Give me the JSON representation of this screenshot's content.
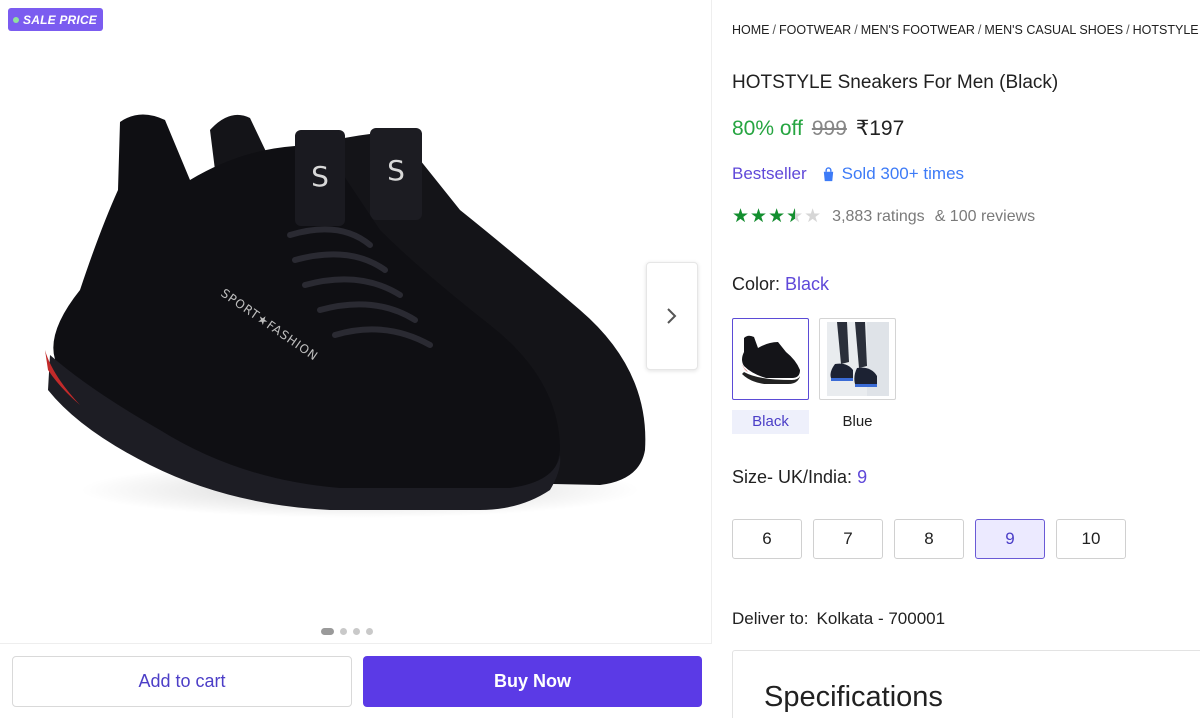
{
  "gallery": {
    "badge": "SALE PRICE",
    "image_count": 4,
    "active_image": 1,
    "add_to_cart_label": "Add to cart",
    "buy_now_label": "Buy Now",
    "next_icon": "chevron-right-icon"
  },
  "breadcrumb": [
    "HOME",
    "FOOTWEAR",
    "MEN'S FOOTWEAR",
    "MEN'S CASUAL SHOES",
    "HOTSTYLE"
  ],
  "product": {
    "title": "HOTSTYLE Sneakers For Men (Black)",
    "discount": "80% off",
    "mrp": "999",
    "price": "₹197",
    "bestseller": "Bestseller",
    "sold": "Sold 300+ times",
    "rating_value": 3.5,
    "ratings": "3,883 ratings",
    "reviews": "& 100 reviews"
  },
  "color": {
    "label": "Color:",
    "selected": "Black",
    "options": [
      "Black",
      "Blue"
    ]
  },
  "size": {
    "label": "Size- UK/India:",
    "selected": "9",
    "options": [
      "6",
      "7",
      "8",
      "9",
      "10"
    ]
  },
  "delivery": {
    "label": "Deliver to:",
    "location": "Kolkata - 700001"
  },
  "specifications": {
    "title": "Specifications"
  },
  "colors": {
    "accent": "#5b3ae6",
    "discount_green": "#26a541",
    "star_green": "#138f2f",
    "badge_purple": "#7b5cf0"
  }
}
